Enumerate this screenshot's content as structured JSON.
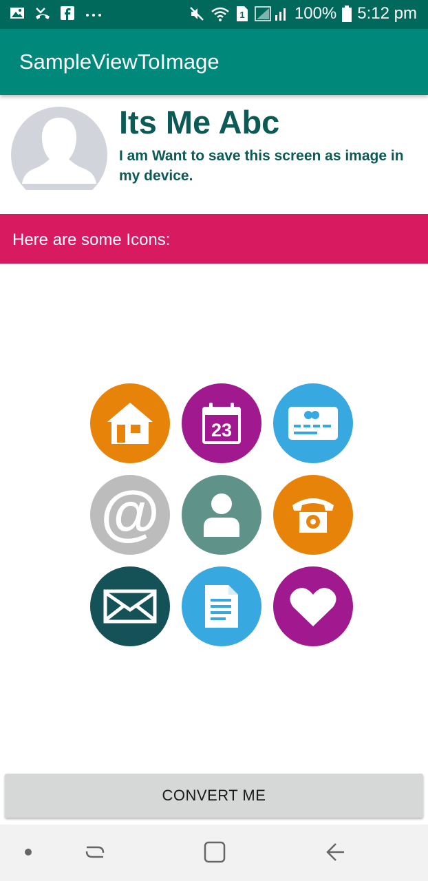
{
  "status_bar": {
    "battery_text": "100%",
    "time": "5:12 pm",
    "icons_left": [
      "gallery-icon",
      "missed-call-icon",
      "facebook-icon",
      "more-dots-icon"
    ],
    "icons_right": [
      "mute-icon",
      "wifi-icon",
      "sim-icon",
      "signal-icon",
      "battery-icon"
    ]
  },
  "app_bar": {
    "title": "SampleViewToImage"
  },
  "profile": {
    "name": "Its Me Abc",
    "description": "I am Want to save this screen as image in my device."
  },
  "banner": {
    "text": "Here are some Icons:"
  },
  "icons": [
    {
      "name": "home-icon",
      "color": "#e8830a"
    },
    {
      "name": "calendar-icon",
      "color": "#a0198e",
      "label": "23"
    },
    {
      "name": "card-icon",
      "color": "#37a8e0"
    },
    {
      "name": "at-sign-icon",
      "color": "#bcbcbc",
      "label": "@"
    },
    {
      "name": "user-icon",
      "color": "#5f9389"
    },
    {
      "name": "phone-icon",
      "color": "#e8830a"
    },
    {
      "name": "mail-icon",
      "color": "#145257"
    },
    {
      "name": "document-icon",
      "color": "#37a8e0"
    },
    {
      "name": "heart-icon",
      "color": "#a0198e"
    }
  ],
  "convert_button": {
    "label": "CONVERT ME"
  },
  "nav_bar": {
    "items": [
      "dot-icon",
      "recent-apps-icon",
      "home-nav-icon",
      "back-icon"
    ]
  },
  "colors": {
    "status_bar": "#00695c",
    "app_bar": "#00897b",
    "banner": "#d81b60",
    "profile_text": "#0b5a55"
  }
}
